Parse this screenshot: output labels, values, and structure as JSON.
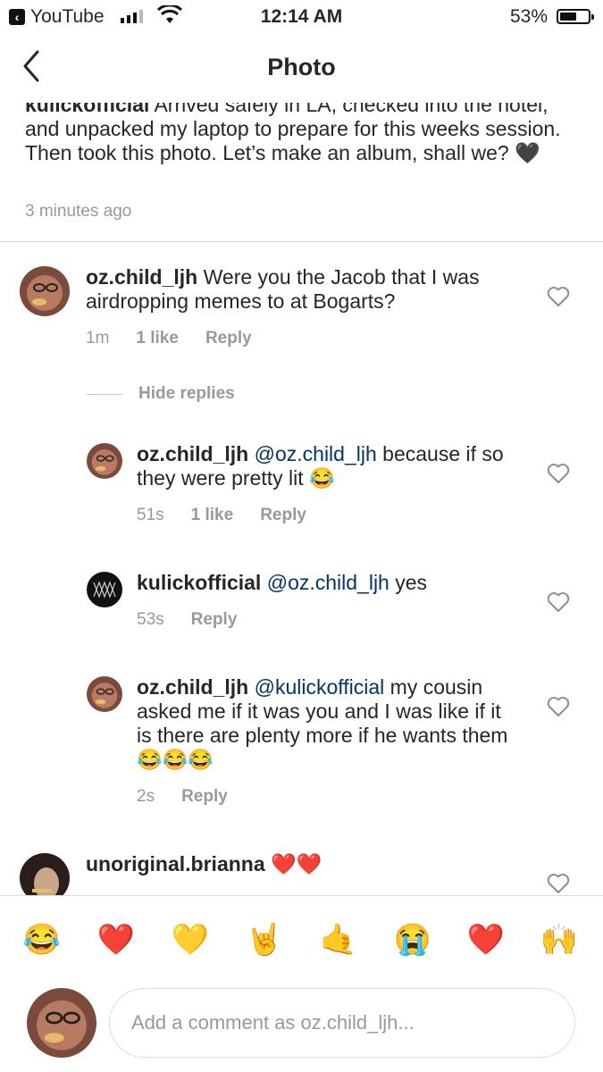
{
  "status": {
    "app_back": "YouTube",
    "time": "12:14 AM",
    "battery": "53%"
  },
  "nav": {
    "title": "Photo"
  },
  "caption": {
    "user": "kulickofficial",
    "text": " Arrived safely in LA, checked into the hotel, and unpacked my laptop to prepare for this weeks session. Then took this photo. Let’s make an album, shall we? 🖤",
    "time": "3 minutes ago"
  },
  "comments": [
    {
      "user": "oz.child_ljh",
      "text": " Were you the Jacob that I was airdropping memes to at Bogarts?",
      "age": "1m",
      "likes": "1 like",
      "reply": "Reply"
    },
    {
      "user": "oz.child_ljh",
      "mention": " @oz.child_ljh",
      "text": " because if so they were pretty lit 😂",
      "age": "51s",
      "likes": "1 like",
      "reply": "Reply"
    },
    {
      "user": "kulickofficial",
      "mention": " @oz.child_ljh",
      "text": " yes",
      "age": "53s",
      "reply": "Reply"
    },
    {
      "user": "oz.child_ljh",
      "mention": " @kulickofficial",
      "text": " my cousin asked me if it was you and I was like if it is there are plenty more if he wants them 😂😂😂",
      "age": "2s",
      "reply": "Reply"
    },
    {
      "user": "unoriginal.brianna",
      "text": " ❤️❤️"
    }
  ],
  "hide_replies": "Hide replies",
  "emoji_bar": [
    "😂",
    "❤️",
    "💛",
    "🤘",
    "🤙",
    "😭",
    "❤️",
    "🙌"
  ],
  "compose": {
    "placeholder": "Add a comment as oz.child_ljh..."
  },
  "colors": {
    "mention": "#003569",
    "meta": "#999999",
    "divider": "#dbdbdb"
  }
}
